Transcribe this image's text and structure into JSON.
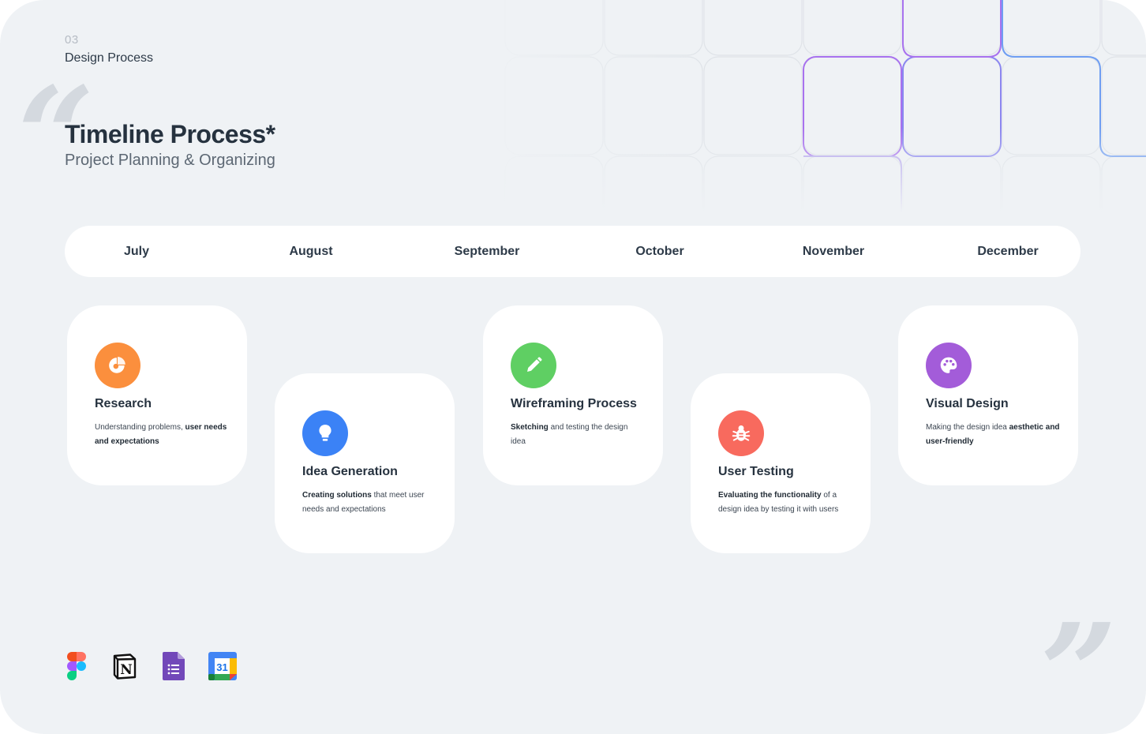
{
  "header": {
    "section_number": "03",
    "section_name": "Design Process",
    "title": "Timeline Process*",
    "subtitle": "Project Planning & Organizing"
  },
  "months": [
    "July",
    "August",
    "September",
    "October",
    "November",
    "December"
  ],
  "cards": [
    {
      "title": "Research",
      "icon": "pie-chart-icon",
      "color": "#fb8f3d",
      "desc_pre": "Understanding problems, ",
      "desc_bold": "user needs and expectations",
      "desc_post": ""
    },
    {
      "title": "Idea Generation",
      "icon": "lightbulb-icon",
      "color": "#3b82f6",
      "desc_pre": "",
      "desc_bold": "Creating solutions",
      "desc_post": " that meet user needs and expectations"
    },
    {
      "title": "Wireframing Process",
      "icon": "pencil-icon",
      "color": "#5fcf63",
      "desc_pre": "",
      "desc_bold": "Sketching",
      "desc_post": " and testing the design idea"
    },
    {
      "title": "User Testing",
      "icon": "bug-icon",
      "color": "#f86a5e",
      "desc_pre": "",
      "desc_bold": "Evaluating the functionality",
      "desc_post": " of a design idea by testing it with users"
    },
    {
      "title": "Visual Design",
      "icon": "palette-icon",
      "color": "#a35cd9",
      "desc_pre": "Making the design idea ",
      "desc_bold": "aesthetic and user-friendly",
      "desc_post": ""
    }
  ],
  "tools": [
    {
      "name": "figma-icon"
    },
    {
      "name": "notion-icon",
      "glyph": "N"
    },
    {
      "name": "google-forms-icon"
    },
    {
      "name": "google-calendar-icon",
      "glyph": "31"
    }
  ],
  "decoration": {
    "quote_open": "“",
    "quote_close": "”"
  }
}
